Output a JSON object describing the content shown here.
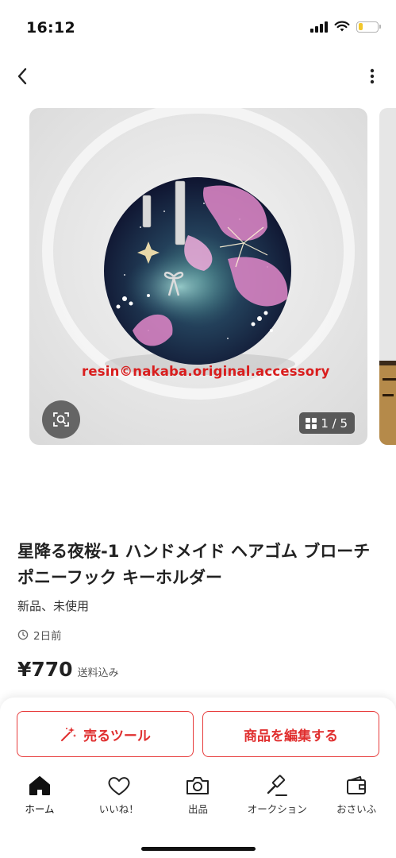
{
  "status_bar": {
    "time": "16:12",
    "battery_level": 0.25,
    "battery_color": "#f2c72c"
  },
  "nav": {
    "back_icon": "chevron-left-icon",
    "more_icon": "more-vertical-icon"
  },
  "carousel": {
    "watermark": "resin©nakaba.original.accessory",
    "page_counter": "1 / 5",
    "zoom_icon": "image-search-icon",
    "grid_icon": "grid-icon"
  },
  "product": {
    "title": "星降る夜桜-1 ハンドメイド ヘアゴム ブローチ ポニーフック キーホルダー",
    "condition": "新品、未使用",
    "posted": "2日前",
    "price": "¥770",
    "shipping": "送料込み"
  },
  "actions": {
    "sell_tool": "売るツール",
    "edit_item": "商品を編集する"
  },
  "tabs": [
    {
      "label": "ホーム",
      "icon": "home-icon"
    },
    {
      "label": "いいね！",
      "icon": "heart-icon"
    },
    {
      "label": "出品",
      "icon": "camera-icon"
    },
    {
      "label": "オークション",
      "icon": "gavel-icon"
    },
    {
      "label": "おさいふ",
      "icon": "wallet-icon"
    }
  ],
  "colors": {
    "accent": "#e02f2f"
  }
}
